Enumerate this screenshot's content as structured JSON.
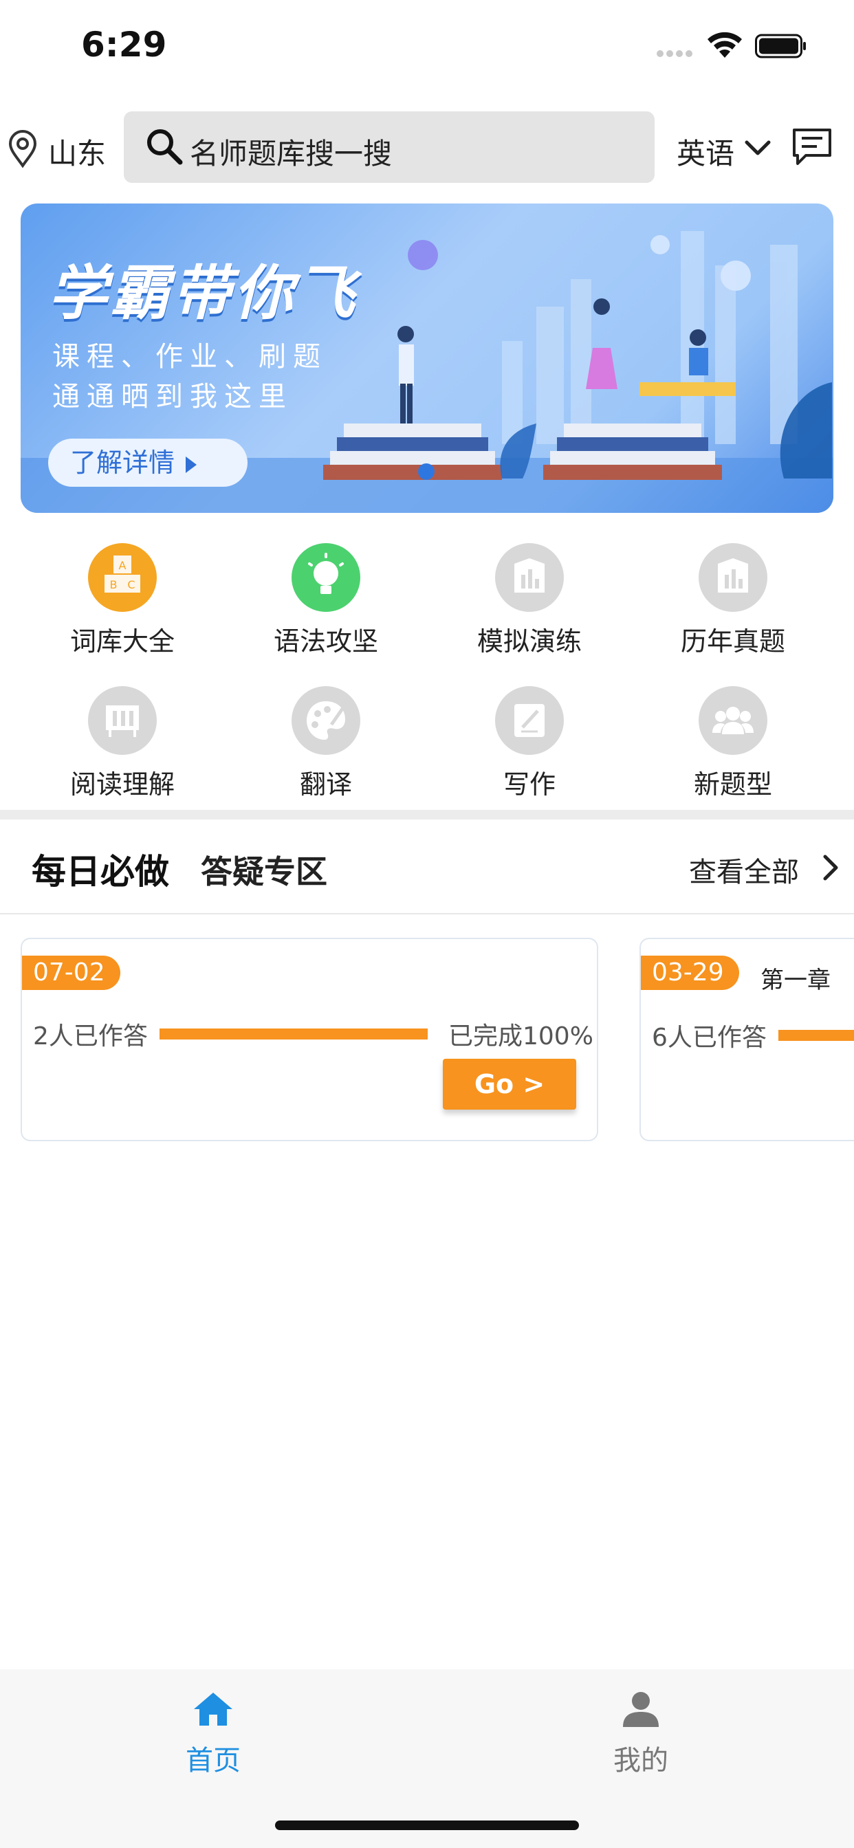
{
  "status_bar": {
    "time": "6:29"
  },
  "header": {
    "location": "山东",
    "search_placeholder": "名师题库搜一搜",
    "subject": "英语"
  },
  "banner": {
    "title": "学霸带你飞",
    "subtitle_line1": "课程、作业、刷题",
    "subtitle_line2": "通通晒到我这里",
    "button_label": "了解详情"
  },
  "grid": [
    {
      "label": "词库大全",
      "icon": "abc-blocks-icon",
      "color": "#f5a623"
    },
    {
      "label": "语法攻坚",
      "icon": "lightbulb-icon",
      "color": "#4cd16f"
    },
    {
      "label": "模拟演练",
      "icon": "chart-icon",
      "color": "#d8d8d8"
    },
    {
      "label": "历年真题",
      "icon": "chart-icon",
      "color": "#d8d8d8"
    },
    {
      "label": "阅读理解",
      "icon": "board-icon",
      "color": "#d8d8d8"
    },
    {
      "label": "翻译",
      "icon": "palette-icon",
      "color": "#d8d8d8"
    },
    {
      "label": "写作",
      "icon": "edit-icon",
      "color": "#d8d8d8"
    },
    {
      "label": "新题型",
      "icon": "group-icon",
      "color": "#d8d8d8"
    }
  ],
  "section": {
    "title": "每日必做",
    "title2": "答疑专区",
    "view_all": "查看全部"
  },
  "cards": [
    {
      "date": "07-02",
      "answered": "2人已作答",
      "progress": 1.0,
      "done": "已完成100%",
      "go": "Go >",
      "chapter": ""
    },
    {
      "date": "03-29",
      "answered": "6人已作答",
      "progress": 1.0,
      "done": "",
      "go": "",
      "chapter": "第一章"
    }
  ],
  "tabbar": {
    "home": "首页",
    "mine": "我的",
    "active_color": "#1e8fe1",
    "inactive_color": "#777777"
  },
  "colors": {
    "accent": "#f7931e",
    "banner_blue": "#5f9eef"
  }
}
